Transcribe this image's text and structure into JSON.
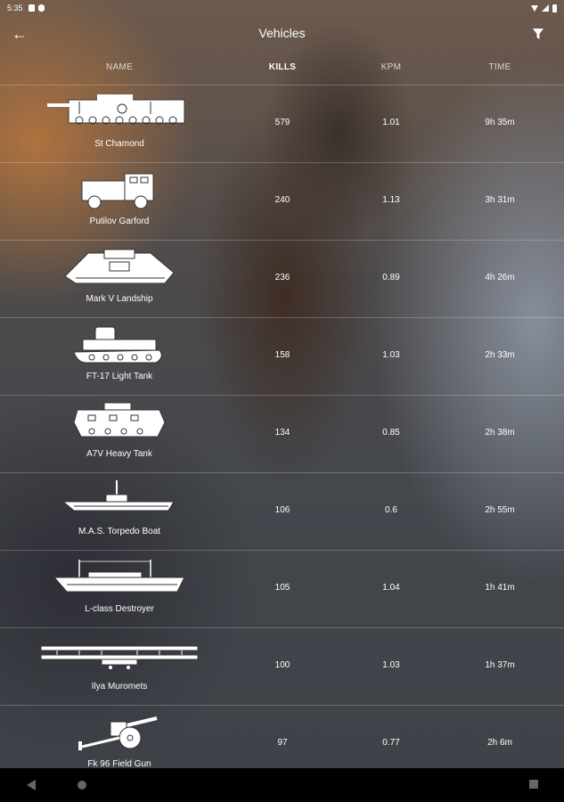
{
  "status_bar": {
    "time": "5:35"
  },
  "app_bar": {
    "title": "Vehicles"
  },
  "columns": {
    "name": "NAME",
    "kills": "KILLS",
    "kpm": "KPM",
    "time": "TIME"
  },
  "vehicles": [
    {
      "name": "St Chamond",
      "kills": "579",
      "kpm": "1.01",
      "time": "9h 35m",
      "icon": "tank-icon"
    },
    {
      "name": "Putilov Garford",
      "kills": "240",
      "kpm": "1.13",
      "time": "3h 31m",
      "icon": "armored-truck-icon"
    },
    {
      "name": "Mark V Landship",
      "kills": "236",
      "kpm": "0.89",
      "time": "4h 26m",
      "icon": "rhomboid-tank-icon"
    },
    {
      "name": "FT-17 Light Tank",
      "kills": "158",
      "kpm": "1.03",
      "time": "2h 33m",
      "icon": "light-tank-icon"
    },
    {
      "name": "A7V Heavy Tank",
      "kills": "134",
      "kpm": "0.85",
      "time": "2h 38m",
      "icon": "heavy-tank-icon"
    },
    {
      "name": "M.A.S. Torpedo Boat",
      "kills": "106",
      "kpm": "0.6",
      "time": "2h 55m",
      "icon": "torpedo-boat-icon"
    },
    {
      "name": "L-class Destroyer",
      "kills": "105",
      "kpm": "1.04",
      "time": "1h 41m",
      "icon": "destroyer-icon"
    },
    {
      "name": "Ilya Muromets",
      "kills": "100",
      "kpm": "1.03",
      "time": "1h 37m",
      "icon": "bomber-plane-icon"
    },
    {
      "name": "Fk 96 Field Gun",
      "kills": "97",
      "kpm": "0.77",
      "time": "2h 6m",
      "icon": "field-gun-icon"
    }
  ]
}
